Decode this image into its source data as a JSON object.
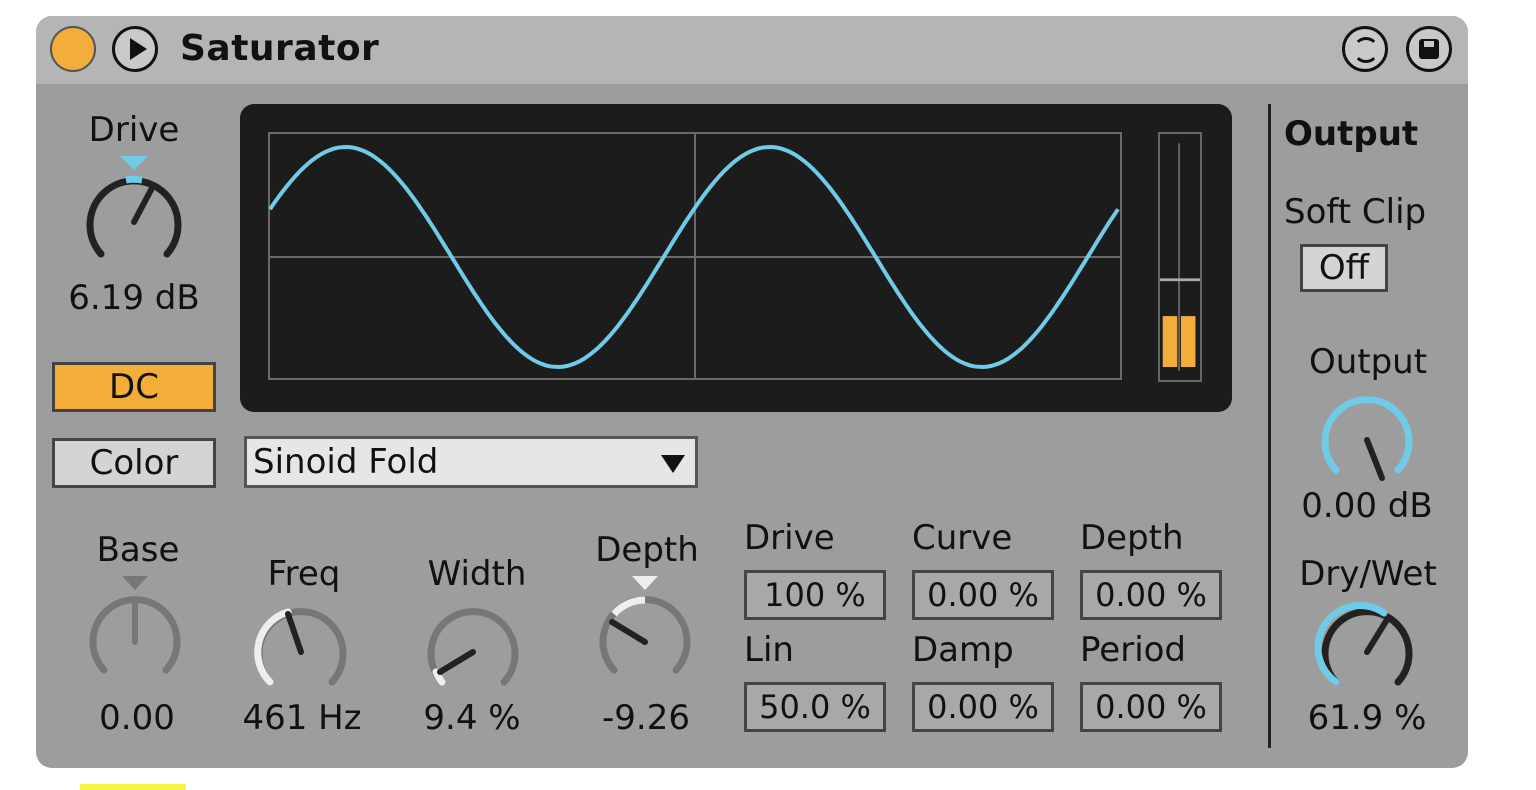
{
  "device": {
    "title": "Saturator",
    "accent_color": "#f2ad3b",
    "curve_color": "#6fcbe6"
  },
  "left": {
    "drive_label": "Drive",
    "drive_value": "6.19 dB",
    "dc_label": "DC",
    "color_label": "Color"
  },
  "waveshaper": {
    "type": "Sinoid Fold"
  },
  "color_knobs": [
    {
      "label": "Base",
      "value": "0.00"
    },
    {
      "label": "Freq",
      "value": "461 Hz"
    },
    {
      "label": "Width",
      "value": "9.4 %"
    },
    {
      "label": "Depth",
      "value": "-9.26"
    }
  ],
  "params": [
    {
      "label": "Drive",
      "value": "100 %"
    },
    {
      "label": "Curve",
      "value": "0.00 %"
    },
    {
      "label": "Depth",
      "value": "0.00 %"
    },
    {
      "label": "Lin",
      "value": "50.0 %"
    },
    {
      "label": "Damp",
      "value": "0.00 %"
    },
    {
      "label": "Period",
      "value": "0.00 %"
    }
  ],
  "output": {
    "section_label": "Output",
    "soft_clip_label": "Soft Clip",
    "soft_clip_value": "Off",
    "output_label": "Output",
    "output_value": "0.00 dB",
    "drywet_label": "Dry/Wet",
    "drywet_value": "61.9 %"
  }
}
